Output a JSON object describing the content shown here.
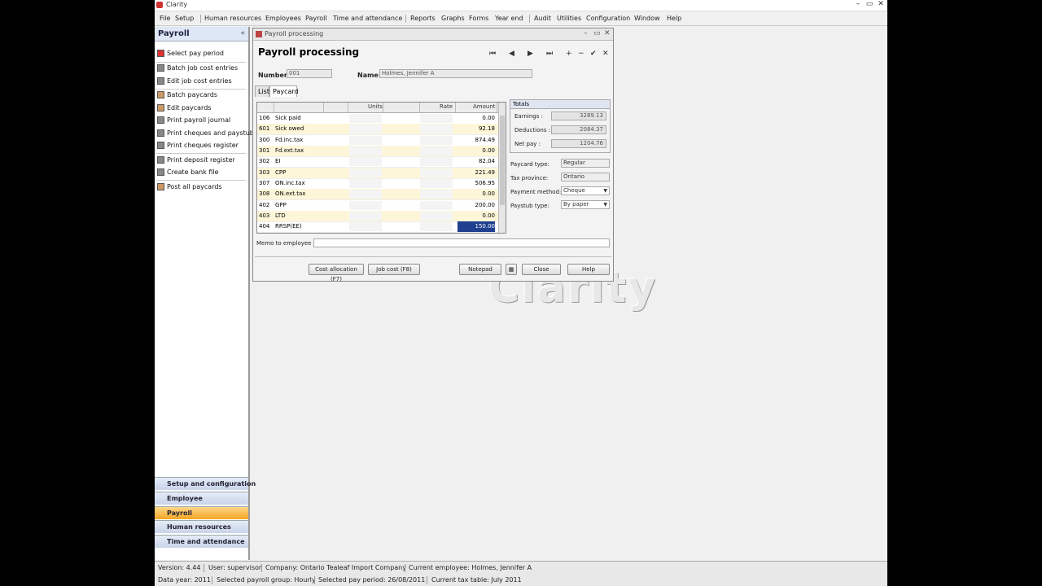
{
  "window": {
    "title": "Clarity",
    "controls": [
      "–",
      "▭",
      "✕"
    ]
  },
  "menu": [
    "File",
    "Setup",
    "Human resources",
    "Employees",
    "Payroll",
    "Time and attendance",
    "Reports",
    "Graphs",
    "Forms",
    "Year end",
    "Audit",
    "Utilities",
    "Configuration",
    "Window",
    "Help"
  ],
  "sidebar": {
    "title": "Payroll",
    "collapse": "«",
    "items": [
      {
        "label": "Select pay period"
      },
      {
        "label": "Batch job cost entries"
      },
      {
        "label": "Edit job cost entries"
      },
      {
        "label": "Batch paycards"
      },
      {
        "label": "Edit paycards"
      },
      {
        "label": "Print payroll journal"
      },
      {
        "label": "Print cheques and paystubs"
      },
      {
        "label": "Print cheques register"
      },
      {
        "label": "Print deposit register"
      },
      {
        "label": "Create bank file"
      },
      {
        "label": "Post all paycards"
      }
    ],
    "groups": [
      "Setup and configuration",
      "Employee",
      "Payroll",
      "Human resources",
      "Time and attendance"
    ],
    "active_group": "Payroll"
  },
  "child": {
    "caption": "Payroll processing",
    "heading": "Payroll processing",
    "nav_buttons": [
      "⏮",
      "◀",
      "▶",
      "⏭",
      "+",
      "−",
      "✔",
      "✕"
    ],
    "number_label": "Number:",
    "number_value": "001",
    "name_label": "Name:",
    "name_value": "Holmes, Jennifer A",
    "tabs": [
      "List",
      "Paycard"
    ],
    "columns": {
      "units": "Units",
      "rate": "Rate",
      "amount": "Amount"
    },
    "rows": [
      {
        "code": "106",
        "desc": "Sick paid",
        "amount": "0.00"
      },
      {
        "code": "601",
        "desc": "Sick owed",
        "amount": "92.18"
      },
      {
        "code": "300",
        "desc": "Fd.inc.tax",
        "amount": "874.49"
      },
      {
        "code": "301",
        "desc": "Fd.ext.tax",
        "amount": "0.00"
      },
      {
        "code": "302",
        "desc": "EI",
        "amount": "82.04"
      },
      {
        "code": "303",
        "desc": "CPP",
        "amount": "221.49"
      },
      {
        "code": "307",
        "desc": "ON.inc.tax",
        "amount": "506.95"
      },
      {
        "code": "308",
        "desc": "ON.ext.tax",
        "amount": "0.00"
      },
      {
        "code": "402",
        "desc": "GPP",
        "amount": "200.00"
      },
      {
        "code": "403",
        "desc": "LTD",
        "amount": "0.00"
      },
      {
        "code": "404",
        "desc": "RRSP(EE)",
        "amount": "150.00"
      }
    ],
    "totals": {
      "title": "Totals",
      "earnings_label": "Earnings :",
      "earnings": "3289.13",
      "deductions_label": "Deductions :",
      "deductions": "2084.37",
      "netpay_label": "Net pay :",
      "netpay": "1204.76"
    },
    "props": [
      {
        "label": "Paycard type:",
        "value": "Regular"
      },
      {
        "label": "Tax province:",
        "value": "Ontario"
      },
      {
        "label": "Payment method:",
        "value": "Cheque"
      },
      {
        "label": "Paystub type:",
        "value": "By paper"
      }
    ],
    "memo_label": "Memo to employee :",
    "buttons": {
      "cost_allocation": "Cost allocation (F7)",
      "job_cost": "Job cost (F8)",
      "notepad": "Notepad",
      "close": "Close",
      "help": "Help"
    }
  },
  "watermark": "Clarity",
  "status": {
    "version": "Version: 4.44",
    "user": "User: supervisor",
    "company": "Company: Ontario Tealeaf Import Company",
    "employee": "Current employee: Holmes, Jennifer A",
    "year": "Data year: 2011",
    "group": "Selected payroll group: Hourly",
    "period": "Selected pay period: 26/08/2011",
    "taxtable": "Current tax table: July 2011"
  }
}
